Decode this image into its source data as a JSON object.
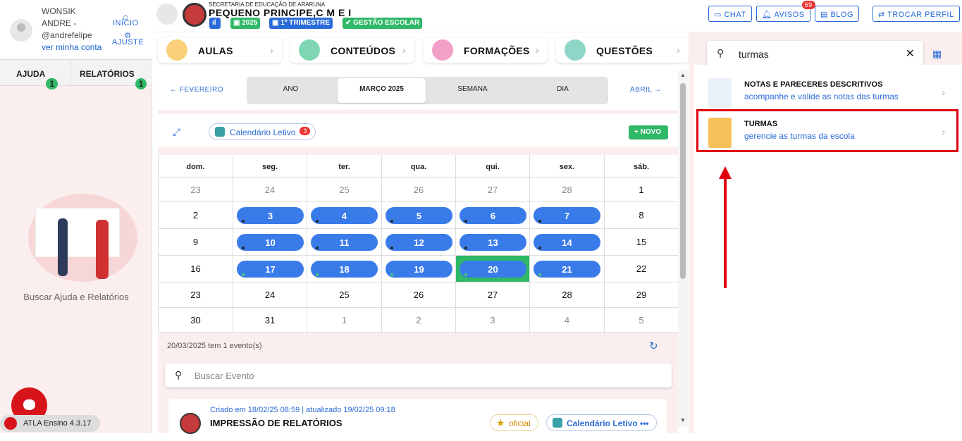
{
  "user": {
    "name": "WONSIK ANDRE - @andrefelipe",
    "link": "ver minha conta"
  },
  "nav": {
    "inicio": "INÍCIO",
    "ajuste": "AJUSTE"
  },
  "left_tabs": [
    {
      "label": "AJUDA",
      "badge": "1"
    },
    {
      "label": "RELATÓRIOS",
      "badge": "1"
    }
  ],
  "help_text": "Buscar Ajuda e Relatórios",
  "version": "ATLA Ensino 4.3.17",
  "header": {
    "secretaria": "SECRETARIA DE EDUCAÇÃO DE ARARUNA",
    "school": "PEQUENO PRINCIPE,C M E I",
    "year": "2025",
    "term": "1º TRIMESTRE",
    "module": "GESTÃO ESCOLAR",
    "chat": "CHAT",
    "avisos": "AVISOS",
    "avisos_count": "69",
    "blog": "BLOG",
    "trocar": "TROCAR PERFIL"
  },
  "modules": [
    "AULAS",
    "CONTEÚDOS",
    "FORMAÇÕES",
    "QUESTÕES"
  ],
  "calendar": {
    "prev": "← FEVEREIRO",
    "next": "ABRIL →",
    "views": [
      "ANO",
      "MARÇO 2025",
      "SEMANA",
      "DIA"
    ],
    "calendar_chip": "Calendário Letivo",
    "calendar_badge": "3",
    "novo": "+ NOVO",
    "weekdays": [
      "dom.",
      "seg.",
      "ter.",
      "qua.",
      "qui.",
      "sex.",
      "sáb."
    ],
    "weeks": [
      [
        "23",
        "24",
        "25",
        "26",
        "27",
        "28",
        "1"
      ],
      [
        "2",
        "3",
        "4",
        "5",
        "6",
        "7",
        "8"
      ],
      [
        "9",
        "10",
        "11",
        "12",
        "13",
        "14",
        "15"
      ],
      [
        "16",
        "17",
        "18",
        "19",
        "20",
        "21",
        "22"
      ],
      [
        "23",
        "24",
        "25",
        "26",
        "27",
        "28",
        "29"
      ],
      [
        "30",
        "31",
        "1",
        "2",
        "3",
        "4",
        "5"
      ]
    ],
    "status": "20/03/2025 tem 1 evento(s)",
    "search_placeholder": "Buscar Evento",
    "event": {
      "meta": "Criado em 18/02/25 08:59 | atualizado 19/02/25 09:18",
      "title": "IMPRESSÃO DE RELATÓRIOS",
      "tag_oficial": "oficial",
      "tag_calendar": "Calendário Letivo  •••"
    }
  },
  "right_panel": {
    "search_value": "turmas",
    "items": [
      {
        "title": "NOTAS E PARECERES DESCRITIVOS",
        "subtitle": "acompanhe e valide as notas das turmas"
      },
      {
        "title": "TURMAS",
        "subtitle": "gerencie as turmas da escola"
      }
    ]
  },
  "colors": {
    "accent": "#2a6bd8",
    "event_blue": "#3a7bea",
    "green": "#2fb866",
    "highlight": "#e00010",
    "brand_red": "#d7141a"
  }
}
